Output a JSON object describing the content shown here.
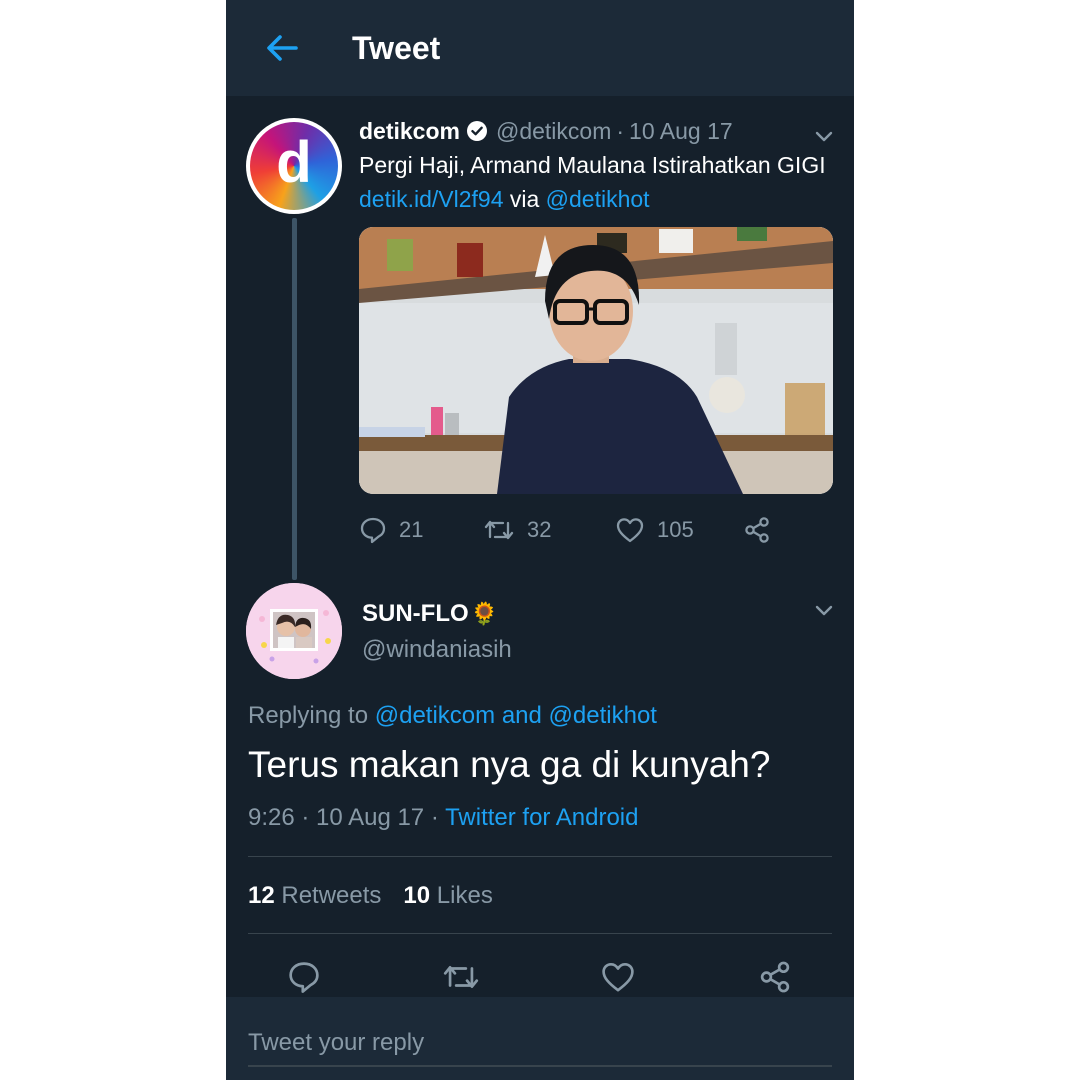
{
  "header": {
    "title": "Tweet",
    "back_icon": "arrow-left-icon",
    "accent_color": "#1da1f2",
    "background": "#15202b"
  },
  "original_tweet": {
    "avatar_letter": "d",
    "name": "detikcom",
    "verified_icon": "verified-badge-icon",
    "handle": "@detikcom",
    "separator": "·",
    "date": "10 Aug 17",
    "text_plain": "Pergi Haji, Armand Maulana Istirahatkan GIGI ",
    "link_text": "detik.id/Vl2f94",
    "via_text": " via ",
    "mention_text": "@detikhot",
    "actions": {
      "reply_count": "21",
      "retweet_count": "32",
      "like_count": "105"
    }
  },
  "reply_tweet": {
    "name": "SUN-FLO",
    "name_emoji": "🌻",
    "handle": "@windaniasih",
    "replying_prefix": "Replying to ",
    "replying_mention_1": "@detikcom",
    "replying_and": " and ",
    "replying_mention_2": "@detikhot",
    "text": "Terus makan nya ga di kunyah?",
    "time": "9:26",
    "sep": " · ",
    "date": "10 Aug 17",
    "source": "Twitter for Android",
    "retweets_count": "12",
    "retweets_label": " Retweets",
    "likes_count": "10",
    "likes_label": " Likes"
  },
  "reply_box": {
    "placeholder": "Tweet your reply"
  }
}
